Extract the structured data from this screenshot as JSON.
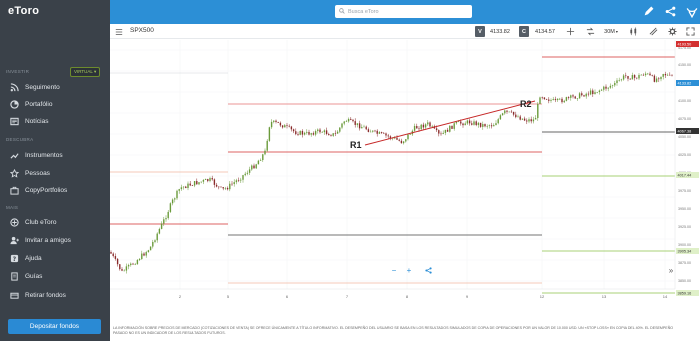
{
  "sidebar": {
    "logo": "eToro",
    "section_investir": "INVESTIR",
    "virtual_badge": "VIRTUAL ▾",
    "section_descubra": "DESCUBRA",
    "section_mais": "MAIS",
    "items": [
      {
        "label": "Seguimento",
        "icon": "feed-icon"
      },
      {
        "label": "Portafólio",
        "icon": "portfolio-icon"
      },
      {
        "label": "Notícias",
        "icon": "news-icon"
      },
      {
        "label": "Instrumentos",
        "icon": "trending-icon"
      },
      {
        "label": "Pessoas",
        "icon": "star-icon"
      },
      {
        "label": "CopyPortfolios",
        "icon": "copyportfolio-icon"
      },
      {
        "label": "Club eToro",
        "icon": "club-icon"
      },
      {
        "label": "Invitar a amigos",
        "icon": "invite-icon"
      },
      {
        "label": "Ajuda",
        "icon": "help-icon"
      },
      {
        "label": "Guías",
        "icon": "guides-icon"
      },
      {
        "label": "Retirar fondos",
        "icon": "withdraw-icon"
      }
    ],
    "deposit_label": "Depositar fondos"
  },
  "topbar": {
    "search_placeholder": "Busca eToro"
  },
  "toolbar": {
    "symbol": "SPX500",
    "sell_tag": "V",
    "sell_price": "4133.82",
    "buy_tag": "C",
    "buy_price": "4134.57",
    "timeframe": "30M"
  },
  "chart": {
    "annotations": [
      "R1",
      "R2"
    ],
    "x_ticks": [
      "",
      "2",
      "5",
      "6",
      "7",
      "8",
      "9",
      "12",
      "13",
      "14"
    ],
    "y_ticks": [
      "4175.00",
      "4150.00",
      "4125.00",
      "4100.00",
      "4075.00",
      "4050.00",
      "4025.00",
      "4000.00",
      "3975.00",
      "3950.00",
      "3925.00",
      "3900.00",
      "3875.00",
      "3850.00"
    ],
    "price_labels": [
      {
        "text": "4193.50",
        "color": "#d32f2f"
      },
      {
        "text": "4133.82",
        "color": "#2c8fd6"
      },
      {
        "text": "4067.38",
        "color": "#333333"
      },
      {
        "text": "4017.44",
        "color": "#8bc34a"
      },
      {
        "text": "3905.34",
        "color": "#8bc34a"
      },
      {
        "text": "3859.16",
        "color": "#8bc34a"
      }
    ]
  },
  "disclaimer": "LA INFORMACIÓN SOBRE PRECIOS DE MERCADO (COTIZACIONES DE VENTA) SE OFRECE ÚNICAMENTE A TÍTULO INFORMATIVO. EL DESEMPEÑO DEL USUARIO SE BASA EN LOS RESULTADOS SIMULADOS DE COPIA DE OPERACIONES POR UN VALOR DE 10.000 USD. UN «STOP LOSS» EN COPIA DEL 40%. EL DESEMPEÑO PASADO NO ES UN INDICADOR DE LOS RESULTADOS FUTUROS."
}
